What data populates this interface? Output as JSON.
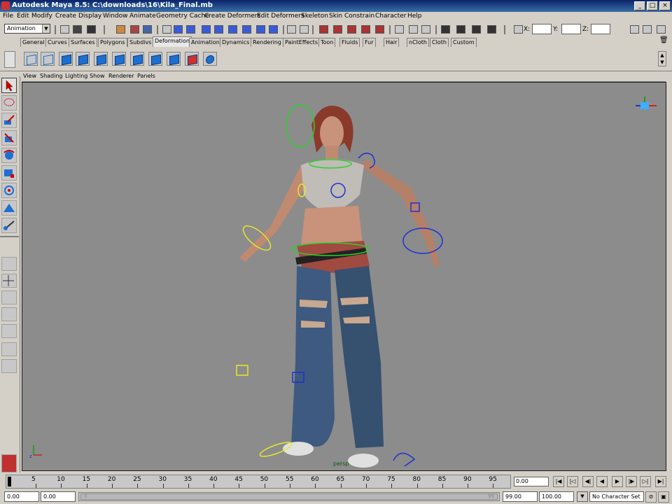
{
  "window": {
    "title": "Autodesk Maya 8.5: C:\\downloads\\16\\Kila_Final.mb",
    "minimize_icon": "minimize-icon",
    "maximize_icon": "maximize-icon",
    "close_icon": "close-icon"
  },
  "menubar": {
    "items": [
      "File",
      "Edit",
      "Modify",
      "Create",
      "Display",
      "Window",
      "Animate",
      "Geometry Cache",
      "Create Deformers",
      "Edit Deformers",
      "Skeleton",
      "Skin",
      "Constrain",
      "Character",
      "Help"
    ]
  },
  "statusline": {
    "menuset": "Animation",
    "x_label": "X:",
    "y_label": "Y:",
    "z_label": "Z:",
    "x_value": "",
    "y_value": "",
    "z_value": ""
  },
  "shelf": {
    "tabs": [
      "General",
      "Curves",
      "Surfaces",
      "Polygons",
      "Subdivs",
      "Deformation",
      "Animation",
      "Dynamics",
      "Rendering",
      "PaintEffects",
      "Toon",
      "Fluids",
      "Fur",
      "Hair",
      "nCloth",
      "Cloth",
      "Custom"
    ],
    "active_tab": "Deformation",
    "icons": [
      "cluster-icon",
      "lattice-icon",
      "blendshape-icon",
      "wrap-icon",
      "sculpt-icon",
      "wire-icon",
      "nonlinear-icon",
      "jiggle-icon",
      "soft-mod-icon",
      "paint-weights-icon",
      "wire-dropoff-icon"
    ]
  },
  "panel": {
    "menus": [
      "View",
      "Shading",
      "Lighting",
      "Show",
      "Renderer",
      "Panels"
    ],
    "camera_label": "persp",
    "bg_color": "#8c8c8c"
  },
  "timeslider": {
    "ticks": [
      "5",
      "10",
      "15",
      "20",
      "25",
      "30",
      "35",
      "40",
      "45",
      "50",
      "55",
      "60",
      "65",
      "70",
      "75",
      "80",
      "85",
      "90",
      "95"
    ],
    "current_frame": "0.00"
  },
  "rangebar": {
    "anim_start": "0.00",
    "range_start": "0.00",
    "slider_label": "0",
    "slider_end_label": "99",
    "range_end": "99.00",
    "anim_end": "100.00",
    "character_set": "No Character Set"
  }
}
